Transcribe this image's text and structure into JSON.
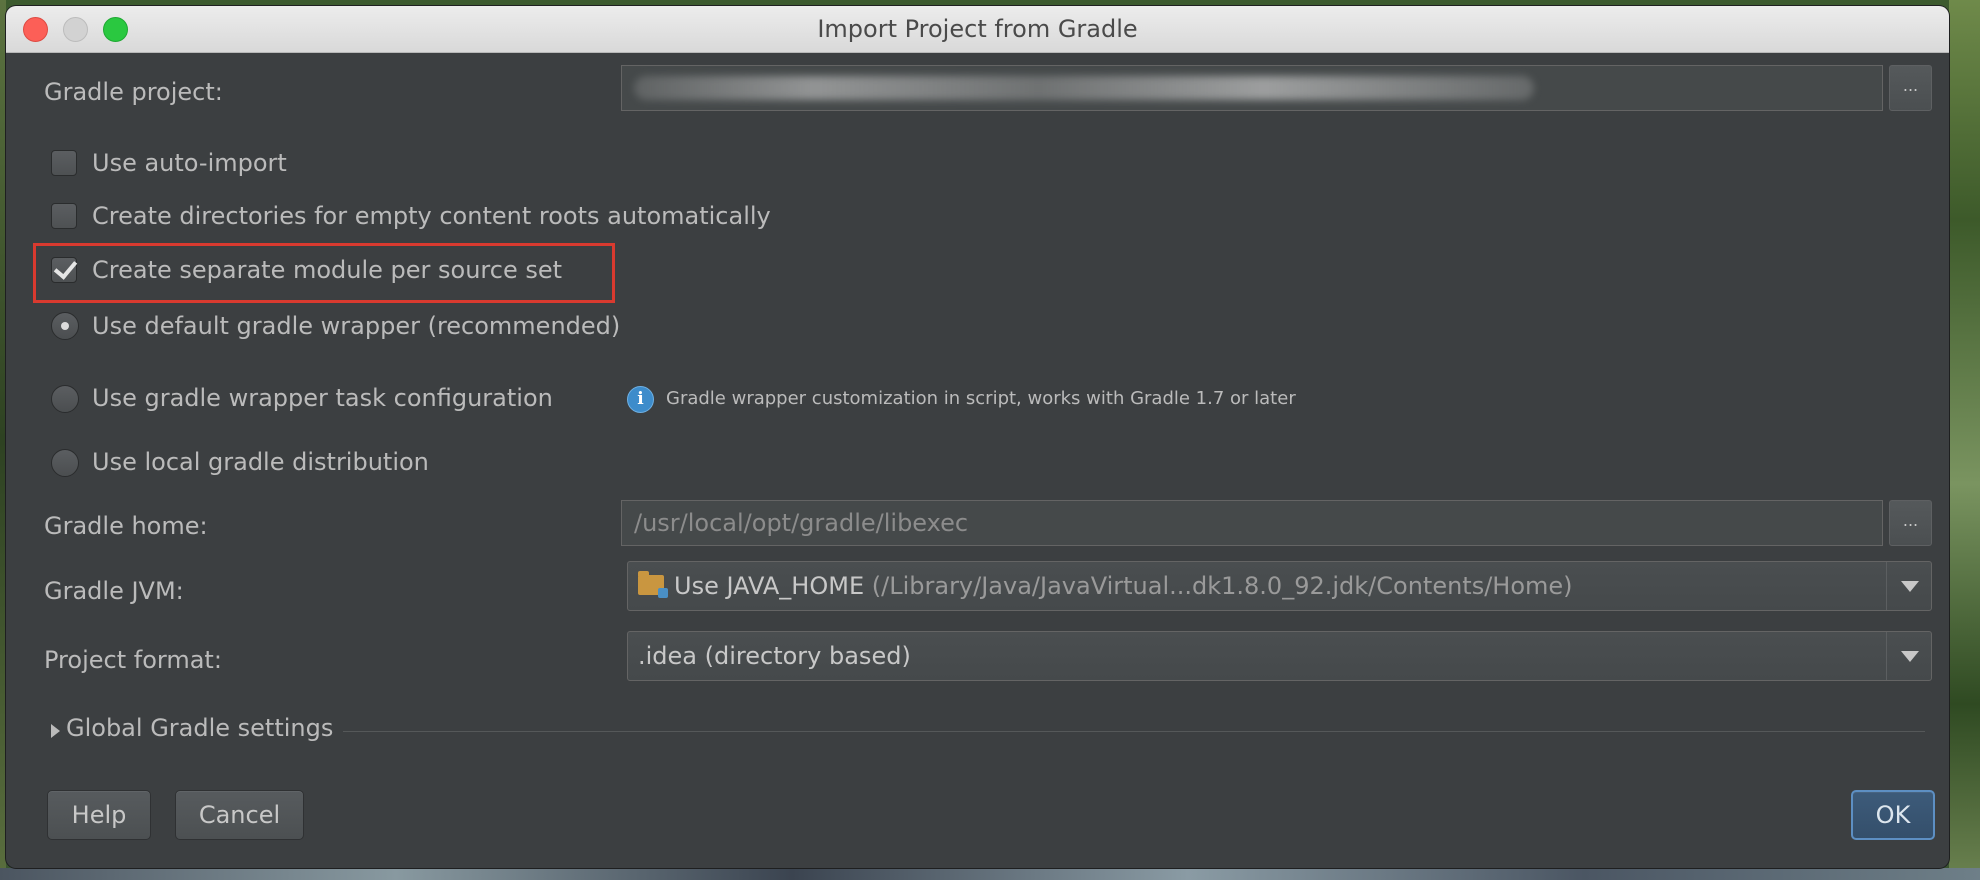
{
  "window": {
    "title": "Import Project from Gradle"
  },
  "gradle_project": {
    "label": "Gradle project:",
    "browse_label": "..."
  },
  "options": {
    "auto_import": {
      "label": "Use auto-import",
      "checked": false
    },
    "create_dirs": {
      "label": "Create directories for empty content roots automatically",
      "checked": false
    },
    "separate_module": {
      "label": "Create separate module per source set",
      "checked": true
    }
  },
  "wrapper": {
    "default": {
      "label": "Use default gradle wrapper (recommended)",
      "selected": true
    },
    "task_config": {
      "label": "Use gradle wrapper task configuration",
      "selected": false
    },
    "local": {
      "label": "Use local gradle distribution",
      "selected": false
    },
    "info": "Gradle wrapper customization in script, works with Gradle 1.7 or later"
  },
  "gradle_home": {
    "label": "Gradle home:",
    "value": "/usr/local/opt/gradle/libexec",
    "browse_label": "..."
  },
  "gradle_jvm": {
    "label": "Gradle JVM:",
    "value_main": "Use JAVA_HOME",
    "value_path": "(/Library/Java/JavaVirtual...dk1.8.0_92.jdk/Contents/Home)"
  },
  "project_format": {
    "label": "Project format:",
    "value": ".idea (directory based)"
  },
  "global_settings": {
    "label": "Global Gradle settings"
  },
  "buttons": {
    "help": "Help",
    "cancel": "Cancel",
    "ok": "OK"
  },
  "colors": {
    "highlight": "#d93a2f",
    "dialog_bg": "#3c3f41",
    "ok_border": "#5d8fc3"
  }
}
